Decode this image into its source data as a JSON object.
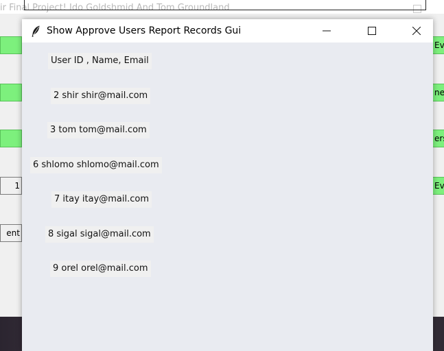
{
  "background_app": {
    "title": "ir Final Project! Ido Goldshmid And Tom Groundland",
    "left_buttons": [
      "",
      "",
      "",
      "1",
      "ent"
    ],
    "right_buttons": [
      "Ev",
      "ne",
      "ers",
      "Eve"
    ]
  },
  "window": {
    "title": "Show Approve Users Report Records Gui",
    "icon": "feather-icon",
    "controls": [
      "minimize-icon",
      "maximize-icon",
      "close-icon"
    ]
  },
  "records": [
    "User ID , Name, Email",
    "2 shir shir@mail.com",
    "3 tom tom@mail.com",
    "6 shlomo shlomo@mail.com",
    "7 itay itay@mail.com",
    "8 sigal sigal@mail.com",
    "9 orel orel@mail.com"
  ],
  "colors": {
    "window_bg": "#e9ebf1",
    "label_bg": "#f0f0f0",
    "bg_button_green": "#7df07d"
  }
}
